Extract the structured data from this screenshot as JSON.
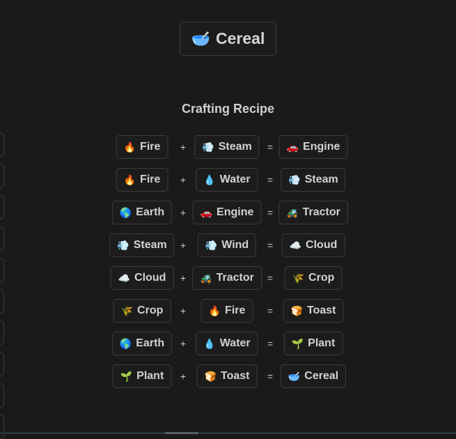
{
  "result": {
    "emoji": "🥣",
    "name": "Cereal"
  },
  "section_title": "Crafting Recipe",
  "operators": {
    "plus": "+",
    "equals": "="
  },
  "recipes": [
    {
      "a": {
        "emoji": "🔥",
        "name": "Fire"
      },
      "b": {
        "emoji": "💨",
        "name": "Steam"
      },
      "c": {
        "emoji": "🚗",
        "name": "Engine"
      }
    },
    {
      "a": {
        "emoji": "🔥",
        "name": "Fire"
      },
      "b": {
        "emoji": "💧",
        "name": "Water"
      },
      "c": {
        "emoji": "💨",
        "name": "Steam"
      }
    },
    {
      "a": {
        "emoji": "🌎",
        "name": "Earth"
      },
      "b": {
        "emoji": "🚗",
        "name": "Engine"
      },
      "c": {
        "emoji": "🚜",
        "name": "Tractor"
      }
    },
    {
      "a": {
        "emoji": "💨",
        "name": "Steam"
      },
      "b": {
        "emoji": "💨",
        "name": "Wind"
      },
      "c": {
        "emoji": "☁️",
        "name": "Cloud"
      }
    },
    {
      "a": {
        "emoji": "☁️",
        "name": "Cloud"
      },
      "b": {
        "emoji": "🚜",
        "name": "Tractor"
      },
      "c": {
        "emoji": "🌾",
        "name": "Crop"
      }
    },
    {
      "a": {
        "emoji": "🌾",
        "name": "Crop"
      },
      "b": {
        "emoji": "🔥",
        "name": "Fire"
      },
      "c": {
        "emoji": "🍞",
        "name": "Toast"
      }
    },
    {
      "a": {
        "emoji": "🌎",
        "name": "Earth"
      },
      "b": {
        "emoji": "💧",
        "name": "Water"
      },
      "c": {
        "emoji": "🌱",
        "name": "Plant"
      }
    },
    {
      "a": {
        "emoji": "🌱",
        "name": "Plant"
      },
      "b": {
        "emoji": "🍞",
        "name": "Toast"
      },
      "c": {
        "emoji": "🥣",
        "name": "Cereal"
      }
    }
  ]
}
